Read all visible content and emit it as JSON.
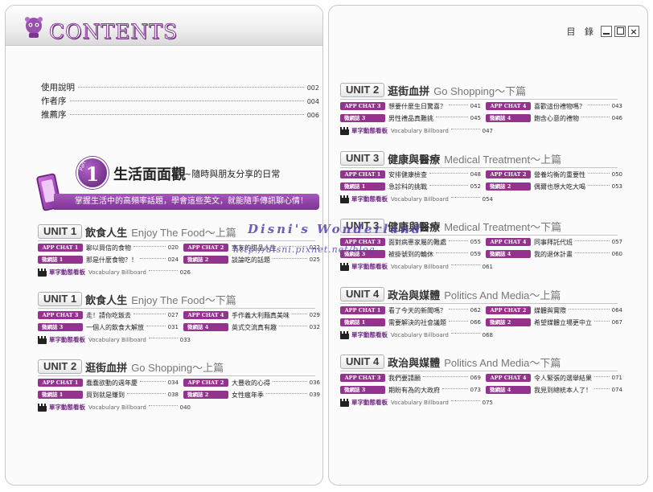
{
  "header": {
    "title": "CONTENTS",
    "window_label": "目 錄",
    "close_glyph": "×",
    "accent": "#8a3c9b"
  },
  "preface": [
    {
      "label": "使用說明",
      "page": "002"
    },
    {
      "label": "作者序",
      "page": "004"
    },
    {
      "label": "推薦序",
      "page": "006"
    }
  ],
  "part": {
    "word": "Part",
    "number": "1",
    "title": "生活面面觀",
    "subtitle": "~隨時與朋友分享的日常",
    "description": "掌握生活中的高頻率話題，學會這些英文，就能隨手傳訊聊心情！"
  },
  "vocab": {
    "label": "單字動態看板",
    "en": "Vocabulary Billboard"
  },
  "units": [
    {
      "unit": "UNIT 1",
      "zh": "飲食人生",
      "en": "Enjoy The Food～上篇",
      "rows": [
        [
          {
            "tag": "APP CHAT 1",
            "title": "聊以買信的食物",
            "page": "020"
          },
          {
            "tag": "APP CHAT 2",
            "title": "室友的甜品人生",
            "page": "022"
          }
        ],
        [
          {
            "tag": "微網誌 1",
            "title": "那是什麼食物？！",
            "page": "024"
          },
          {
            "tag": "微網誌 2",
            "title": "談論吃的話題",
            "page": "025"
          }
        ]
      ],
      "vocab_page": "026"
    },
    {
      "unit": "UNIT 1",
      "zh": "飲食人生",
      "en": "Enjoy The Food～下篇",
      "rows": [
        [
          {
            "tag": "APP CHAT 3",
            "title": "走！請你吃飯去",
            "page": "027"
          },
          {
            "tag": "APP CHAT 4",
            "title": "手作義大利麵真美味",
            "page": "029"
          }
        ],
        [
          {
            "tag": "微網誌 3",
            "title": "一個人的飲食大解放",
            "page": "031"
          },
          {
            "tag": "微網誌 4",
            "title": "英式交流真有趣",
            "page": "032"
          }
        ]
      ],
      "vocab_page": "033"
    },
    {
      "unit": "UNIT 2",
      "zh": "逛街血拼",
      "en": "Go Shopping～上篇",
      "rows": [
        [
          {
            "tag": "APP CHAT 1",
            "title": "蠢蠢欲動的週年慶",
            "page": "034"
          },
          {
            "tag": "APP CHAT 2",
            "title": "大豐收的心得",
            "page": "036"
          }
        ],
        [
          {
            "tag": "微網誌 1",
            "title": "買到就是賺到",
            "page": "038"
          },
          {
            "tag": "微網誌 2",
            "title": "女性瘋年季",
            "page": "039"
          }
        ]
      ],
      "vocab_page": "040"
    },
    {
      "unit": "UNIT 2",
      "zh": "逛街血拼",
      "en": "Go Shopping～下篇",
      "rows": [
        [
          {
            "tag": "APP CHAT 3",
            "title": "想要什麼生日驚喜？",
            "page": "041"
          },
          {
            "tag": "APP CHAT 4",
            "title": "喜歡這份禮物嗎？",
            "page": "043"
          }
        ],
        [
          {
            "tag": "微網誌 3",
            "title": "男性禮品真難挑",
            "page": "045"
          },
          {
            "tag": "微網誌 4",
            "title": "飽含心意的禮物",
            "page": "046"
          }
        ]
      ],
      "vocab_page": "047"
    },
    {
      "unit": "UNIT 3",
      "zh": "健康與醫療",
      "en": "Medical Treatment～上篇",
      "rows": [
        [
          {
            "tag": "APP CHAT 1",
            "title": "安排健康檢查",
            "page": "048"
          },
          {
            "tag": "APP CHAT 2",
            "title": "營養均衡的重要性",
            "page": "050"
          }
        ],
        [
          {
            "tag": "微網誌 1",
            "title": "急診科的挑戰",
            "page": "052"
          },
          {
            "tag": "微網誌 2",
            "title": "偶爾也想大吃大喝",
            "page": "053"
          }
        ]
      ],
      "vocab_page": "054"
    },
    {
      "unit": "UNIT 3",
      "zh": "健康與醫療",
      "en": "Medical Treatment～下篇",
      "rows": [
        [
          {
            "tag": "APP CHAT 3",
            "title": "面對病患家屬的難處",
            "page": "055"
          },
          {
            "tag": "APP CHAT 4",
            "title": "同事拜託代班",
            "page": "057"
          }
        ],
        [
          {
            "tag": "微網誌 3",
            "title": "被掛號到的輪休",
            "page": "059"
          },
          {
            "tag": "微網誌 4",
            "title": "我的退休計畫",
            "page": "060"
          }
        ]
      ],
      "vocab_page": "061"
    },
    {
      "unit": "UNIT 4",
      "zh": "政治與媒體",
      "en": "Politics And Media～上篇",
      "rows": [
        [
          {
            "tag": "APP CHAT 1",
            "title": "看了今天的新聞嗎？",
            "page": "062"
          },
          {
            "tag": "APP CHAT 2",
            "title": "媒體與實際",
            "page": "064"
          }
        ],
        [
          {
            "tag": "微網誌 1",
            "title": "需要解決的社會議題",
            "page": "066"
          },
          {
            "tag": "微網誌 2",
            "title": "希望媒體立場更中立",
            "page": "067"
          }
        ]
      ],
      "vocab_page": "068"
    },
    {
      "unit": "UNIT 4",
      "zh": "政治與媒體",
      "en": "Politics And Media～下篇",
      "rows": [
        [
          {
            "tag": "APP CHAT 3",
            "title": "我們要請願",
            "page": "069"
          },
          {
            "tag": "APP CHAT 4",
            "title": "令人緊張的選舉結果",
            "page": "071"
          }
        ],
        [
          {
            "tag": "微網誌 3",
            "title": "期盼有為的大政府",
            "page": "073"
          },
          {
            "tag": "微網誌 4",
            "title": "我見到總統本人了！",
            "page": "074"
          }
        ]
      ],
      "vocab_page": "075"
    }
  ],
  "watermark": {
    "line1": "Disni's Wonderland",
    "line2": "http://disni.pixnet.net/blog"
  }
}
